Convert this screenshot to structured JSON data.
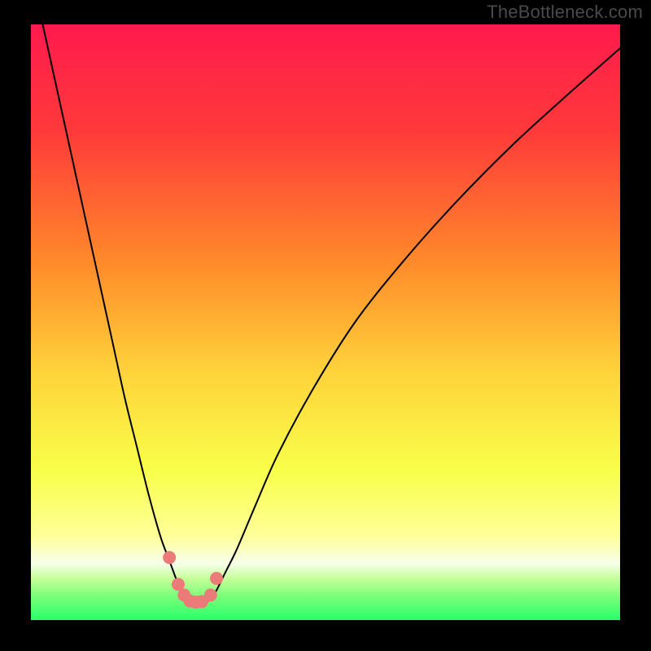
{
  "watermark": "TheBottleneck.com",
  "chart_data": {
    "type": "line",
    "title": "",
    "xlabel": "",
    "ylabel": "",
    "xlim": [
      0,
      100
    ],
    "ylim": [
      0,
      100
    ],
    "grid": false,
    "legend": false,
    "background_gradient": {
      "stops": [
        {
          "offset": 0.0,
          "color": "#ff1a4d"
        },
        {
          "offset": 0.18,
          "color": "#ff3a3a"
        },
        {
          "offset": 0.4,
          "color": "#ff8a2a"
        },
        {
          "offset": 0.58,
          "color": "#ffd23a"
        },
        {
          "offset": 0.75,
          "color": "#f8ff4a"
        },
        {
          "offset": 0.86,
          "color": "#ffff9a"
        },
        {
          "offset": 0.905,
          "color": "#f6ffea"
        },
        {
          "offset": 0.93,
          "color": "#c6ff9a"
        },
        {
          "offset": 0.96,
          "color": "#7aff7a"
        },
        {
          "offset": 1.0,
          "color": "#2aff6a"
        }
      ]
    },
    "series": [
      {
        "name": "curve",
        "type": "line",
        "stroke": "#000000",
        "stroke_width": 2,
        "x": [
          2,
          4,
          6,
          8,
          10,
          12,
          14,
          16,
          18,
          20,
          22,
          23.5,
          25,
          26,
          27,
          27.5,
          28.5,
          29.5,
          30.5,
          31.5,
          33,
          35,
          38,
          42,
          48,
          55,
          63,
          72,
          82,
          92,
          100
        ],
        "y": [
          100,
          91,
          82,
          73,
          64,
          55,
          46,
          37,
          29,
          21,
          14,
          10,
          6,
          4,
          3,
          2.8,
          2.8,
          3,
          3.5,
          5,
          8,
          12,
          19,
          28,
          39,
          50,
          60,
          70,
          80,
          89,
          96
        ]
      },
      {
        "name": "markers",
        "type": "scatter",
        "color": "#ec7a78",
        "radius": 8,
        "x": [
          23.5,
          25.0,
          26.0,
          27.0,
          28.0,
          29.0,
          30.5,
          31.5
        ],
        "y": [
          10.5,
          6.0,
          4.2,
          3.2,
          3.0,
          3.1,
          4.2,
          7.0
        ]
      }
    ]
  }
}
